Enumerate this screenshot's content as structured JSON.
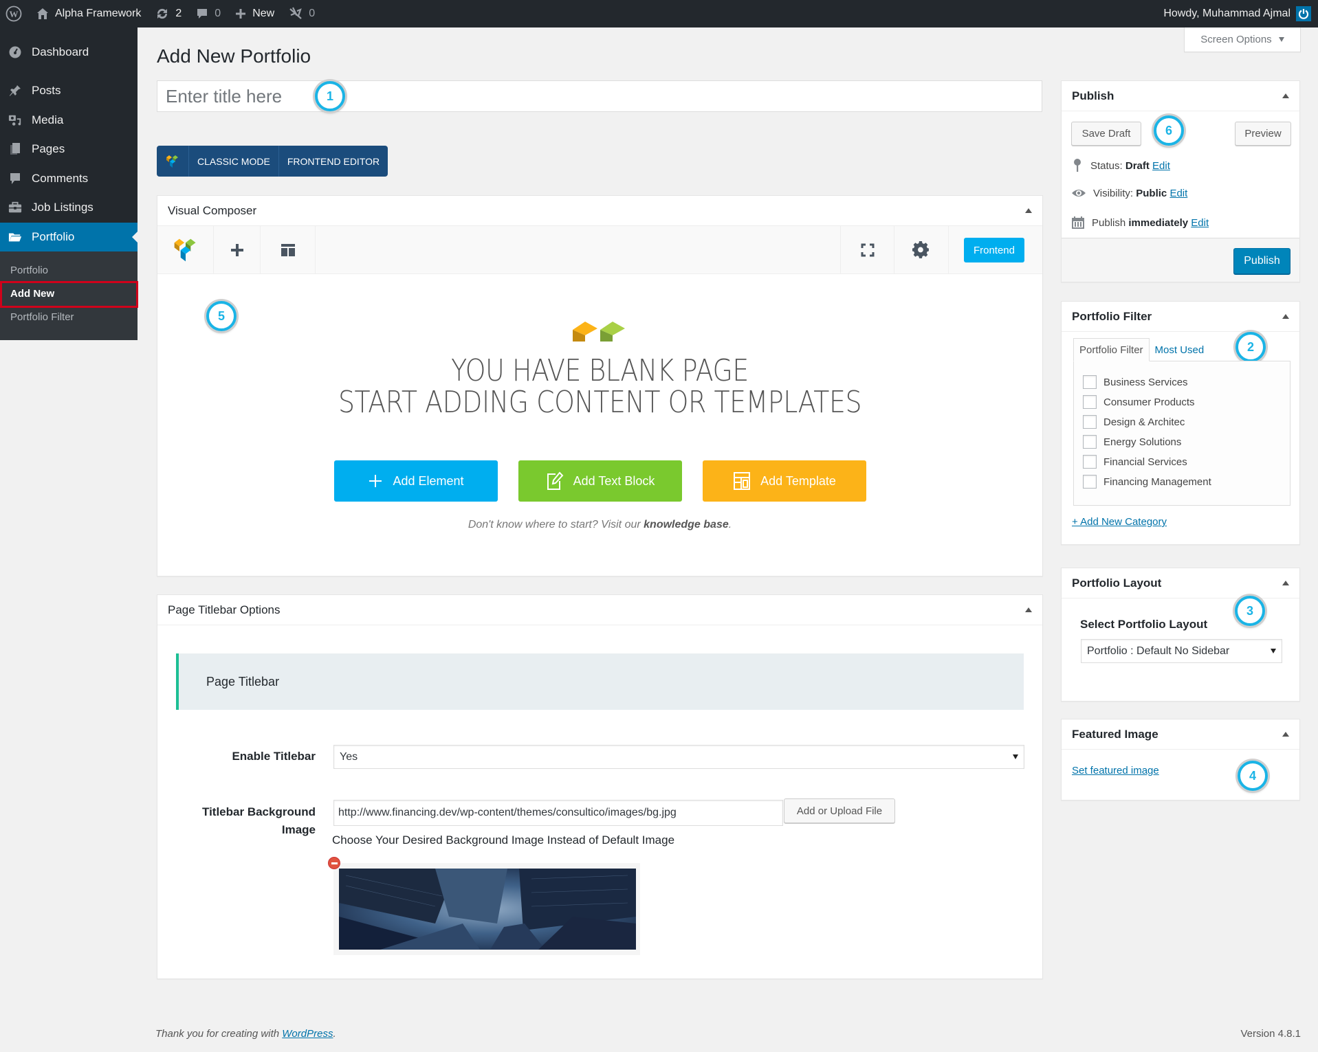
{
  "adminbar": {
    "site_name": "Alpha Framework",
    "updates_count": "2",
    "comments_count": "0",
    "new_label": "New",
    "plugin_count": "0",
    "greeting": "Howdy, Muhammad Ajmal"
  },
  "sidebar": {
    "items": [
      {
        "label": "Dashboard",
        "icon": "dashboard-icon"
      },
      {
        "label": "Posts",
        "icon": "pin-icon"
      },
      {
        "label": "Media",
        "icon": "media-icon"
      },
      {
        "label": "Pages",
        "icon": "pages-icon"
      },
      {
        "label": "Comments",
        "icon": "comment-icon"
      },
      {
        "label": "Job Listings",
        "icon": "briefcase-icon"
      },
      {
        "label": "Portfolio",
        "icon": "folder-icon",
        "active": true
      }
    ],
    "submenu": [
      {
        "label": "Portfolio"
      },
      {
        "label": "Add New",
        "current": true
      },
      {
        "label": "Portfolio Filter"
      }
    ]
  },
  "screen_options_label": "Screen Options",
  "page_title": "Add New Portfolio",
  "title_input": {
    "placeholder": "Enter title here",
    "value": ""
  },
  "annotations": [
    "1",
    "2",
    "3",
    "4",
    "5",
    "6"
  ],
  "vc_switch": {
    "classic_mode": "CLASSIC MODE",
    "frontend_editor": "FRONTEND EDITOR"
  },
  "visual_composer": {
    "title": "Visual Composer",
    "frontend_button": "Frontend",
    "blank_line1": "YOU HAVE BLANK PAGE",
    "blank_line2": "START ADDING CONTENT OR TEMPLATES",
    "add_element": "Add Element",
    "add_text_block": "Add Text Block",
    "add_template": "Add Template",
    "hint_prefix": "Don't know where to start? Visit our ",
    "hint_link": "knowledge base",
    "hint_suffix": ".",
    "colors": {
      "add_element": "#00aeef",
      "add_text_block": "#7ac92e",
      "add_template": "#fcb318"
    }
  },
  "titlebar_options": {
    "title": "Page Titlebar Options",
    "section_label": "Page Titlebar",
    "enable_label": "Enable Titlebar",
    "enable_value": "Yes",
    "bg_label_line1": "Titlebar Background",
    "bg_label_line2": "Image",
    "bg_url": "http://www.financing.dev/wp-content/themes/consultico/images/bg.jpg",
    "upload_button": "Add or Upload File",
    "bg_description": "Choose Your Desired Background Image Instead of Default Image"
  },
  "publish": {
    "title": "Publish",
    "save_draft": "Save Draft",
    "preview": "Preview",
    "status_label": "Status: ",
    "status_value": "Draft",
    "visibility_label": "Visibility: ",
    "visibility_value": "Public",
    "publish_label": "Publish ",
    "publish_value": "immediately",
    "edit_link": "Edit",
    "publish_button": "Publish"
  },
  "portfolio_filter": {
    "title": "Portfolio Filter",
    "tabs": [
      "Portfolio Filter",
      "Most Used"
    ],
    "categories": [
      {
        "label": "Business Services",
        "checked": false
      },
      {
        "label": "Consumer Products",
        "checked": false
      },
      {
        "label": "Design & Architec",
        "checked": false
      },
      {
        "label": "Energy Solutions",
        "checked": false
      },
      {
        "label": "Financial Services",
        "checked": false
      },
      {
        "label": "Financing Management",
        "checked": false
      }
    ],
    "add_new_category": "+ Add New Category"
  },
  "portfolio_layout": {
    "title": "Portfolio Layout",
    "select_label": "Select Portfolio Layout",
    "selected": "Portfolio : Default No Sidebar"
  },
  "featured_image": {
    "title": "Featured Image",
    "set_link": "Set featured image"
  },
  "footer": {
    "thanks_prefix": "Thank you for creating with ",
    "thanks_link": "WordPress",
    "thanks_suffix": ".",
    "version": "Version 4.8.1"
  }
}
